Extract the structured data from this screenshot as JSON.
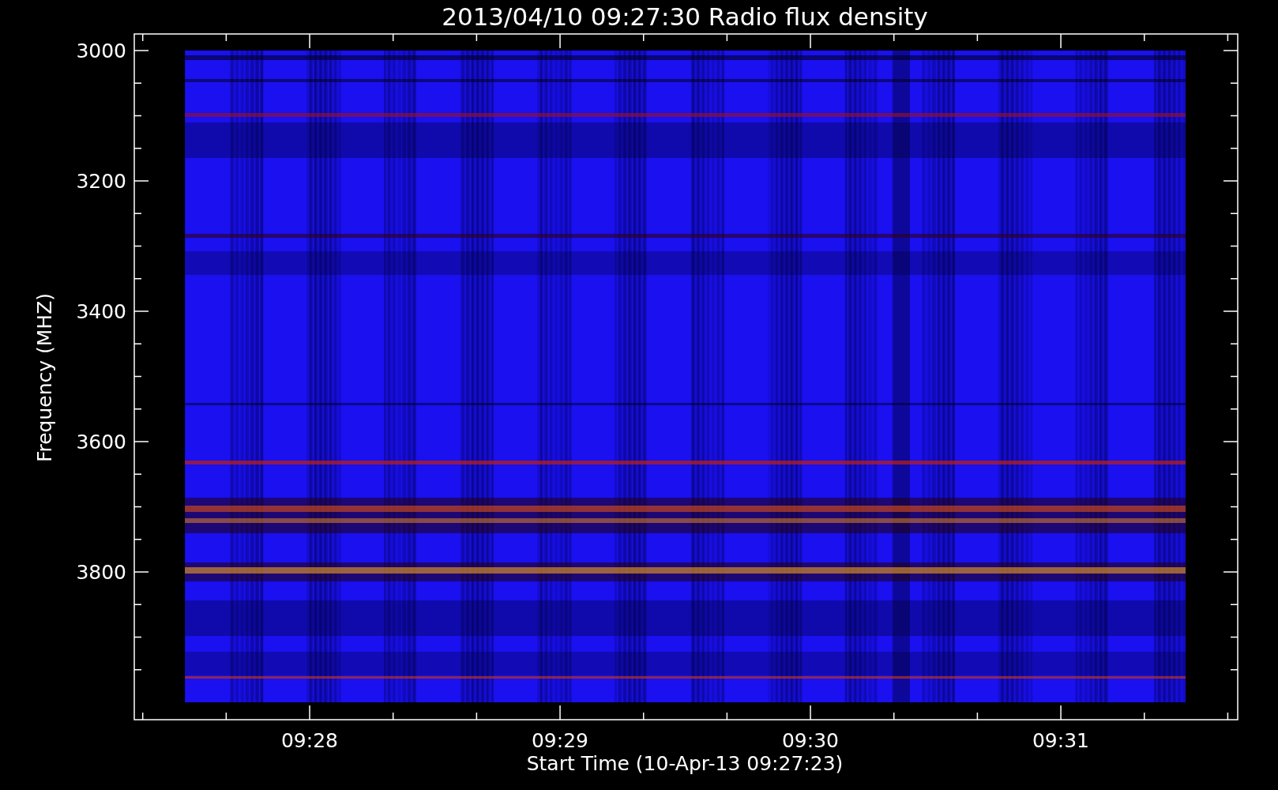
{
  "title": "2013/04/10 09:27:30 Radio flux density",
  "y_axis": {
    "label": "Frequency (MHZ)",
    "ticks": [
      "3000",
      "3200",
      "3400",
      "3600",
      "3800"
    ]
  },
  "x_axis": {
    "label": "Start Time (10-Apr-13 09:27:23)",
    "ticks": [
      "09:28",
      "09:29",
      "09:30",
      "09:31"
    ]
  }
}
